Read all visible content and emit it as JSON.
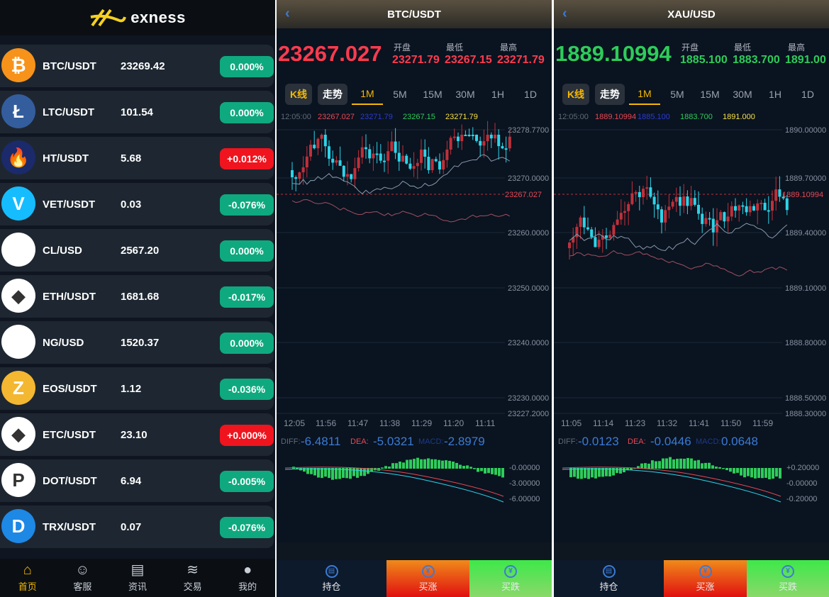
{
  "brand": {
    "name": "exness"
  },
  "list": [
    {
      "symbol": "BTC/USDT",
      "price": "23269.42",
      "change": "0.000%",
      "dir": "up",
      "coin": "btc-icon",
      "color": "#f7931a",
      "glyph": "₿"
    },
    {
      "symbol": "LTC/USDT",
      "price": "101.54",
      "change": "0.000%",
      "dir": "up",
      "coin": "ltc-icon",
      "color": "#345d9d",
      "glyph": "Ł"
    },
    {
      "symbol": "HT/USDT",
      "price": "5.68",
      "change": "+0.012%",
      "dir": "down",
      "coin": "ht-icon",
      "color": "#1b2a6b",
      "glyph": "🔥"
    },
    {
      "symbol": "VET/USDT",
      "price": "0.03",
      "change": "-0.076%",
      "dir": "up",
      "coin": "vet-icon",
      "color": "#15bdff",
      "glyph": "V"
    },
    {
      "symbol": "CL/USD",
      "price": "2567.20",
      "change": "0.000%",
      "dir": "up",
      "coin": "cl-icon",
      "color": "#ffffff",
      "glyph": ""
    },
    {
      "symbol": "ETH/USDT",
      "price": "1681.68",
      "change": "-0.017%",
      "dir": "up",
      "coin": "eth-icon",
      "color": "#ffffff",
      "glyph": "◆"
    },
    {
      "symbol": "NG/USD",
      "price": "1520.37",
      "change": "0.000%",
      "dir": "up",
      "coin": "ng-icon",
      "color": "#ffffff",
      "glyph": ""
    },
    {
      "symbol": "EOS/USDT",
      "price": "1.12",
      "change": "-0.036%",
      "dir": "up",
      "coin": "eos-icon",
      "color": "#f4b731",
      "glyph": "Z"
    },
    {
      "symbol": "ETC/USDT",
      "price": "23.10",
      "change": "+0.000%",
      "dir": "down",
      "coin": "etc-icon",
      "color": "#ffffff",
      "glyph": "◆"
    },
    {
      "symbol": "DOT/USDT",
      "price": "6.94",
      "change": "-0.005%",
      "dir": "up",
      "coin": "dot-icon",
      "color": "#ffffff",
      "glyph": "P"
    },
    {
      "symbol": "TRX/USDT",
      "price": "0.07",
      "change": "-0.076%",
      "dir": "up",
      "coin": "trx-icon",
      "color": "#1e88e5",
      "glyph": "D"
    }
  ],
  "nav": [
    {
      "label": "首页",
      "icon": "home-icon"
    },
    {
      "label": "客服",
      "icon": "support-icon"
    },
    {
      "label": "资讯",
      "icon": "news-icon"
    },
    {
      "label": "交易",
      "icon": "trade-icon"
    },
    {
      "label": "我的",
      "icon": "profile-icon"
    }
  ],
  "colors": {
    "up": "#0fa97f",
    "down": "#f0141e",
    "bull": "#e84855",
    "bear": "#2dd4e8"
  },
  "charts": [
    {
      "title": "BTC/USDT",
      "price": "23267.027",
      "price_color": "#ff3b4e",
      "open_label": "开盘",
      "low_label": "最低",
      "high_label": "最高",
      "open": "23271.79",
      "low": "23267.15",
      "high": "23271.79",
      "val_color": "#ff3b4e",
      "kline_label": "K线",
      "trend_label": "走势",
      "periods": [
        "1M",
        "5M",
        "15M",
        "30M",
        "1H",
        "1D"
      ],
      "ma_time": "12:05:00",
      "ma_vals": [
        "23267.027",
        "23271.79",
        "23267.15",
        "23271.79"
      ],
      "y_ticks": [
        "23278.7700",
        "23270.0000",
        "23260.0000",
        "23250.0000",
        "23240.0000",
        "23230.0000",
        "23227.2000"
      ],
      "current_tag": "23267.027",
      "x_ticks": [
        "12:05",
        "11:56",
        "11:47",
        "11:38",
        "11:29",
        "11:20",
        "11:11"
      ],
      "diff_label": "DIFF:",
      "diff": "-6.4811",
      "dea_label": "DEA:",
      "dea": "-5.0321",
      "macd_label": "MACD:",
      "macd": "-2.8979",
      "macd_ticks": [
        "-0.00000",
        "-3.00000",
        "-6.00000"
      ],
      "actions": {
        "hold": "持仓",
        "buy_up": "买涨",
        "buy_down": "买跌"
      }
    },
    {
      "title": "XAU/USD",
      "price": "1889.10994",
      "price_color": "#2ecc5a",
      "open_label": "开盘",
      "low_label": "最低",
      "high_label": "最高",
      "open": "1885.100",
      "low": "1883.700",
      "high": "1891.00",
      "val_color": "#2ecc5a",
      "kline_label": "K线",
      "trend_label": "走势",
      "periods": [
        "1M",
        "5M",
        "15M",
        "30M",
        "1H",
        "1D"
      ],
      "ma_time": "12:05:00",
      "ma_vals": [
        "1889.10994",
        "1885.100",
        "1883.700",
        "1891.000"
      ],
      "y_ticks": [
        "1890.00000",
        "1889.70000",
        "1889.40000",
        "1889.10000",
        "1888.80000",
        "1888.50000",
        "1888.30000"
      ],
      "current_tag": "1889.10994",
      "x_ticks": [
        "11:05",
        "11:14",
        "11:23",
        "11:32",
        "11:41",
        "11:50",
        "11:59"
      ],
      "diff_label": "DIFF:",
      "diff": "-0.0123",
      "dea_label": "DEA:",
      "dea": "-0.0446",
      "macd_label": "MACD:",
      "macd": "0.0648",
      "macd_ticks": [
        "+0.20000",
        "-0.00000",
        "-0.20000"
      ],
      "actions": {
        "hold": "持仓",
        "buy_up": "买涨",
        "buy_down": "买跌"
      }
    }
  ]
}
